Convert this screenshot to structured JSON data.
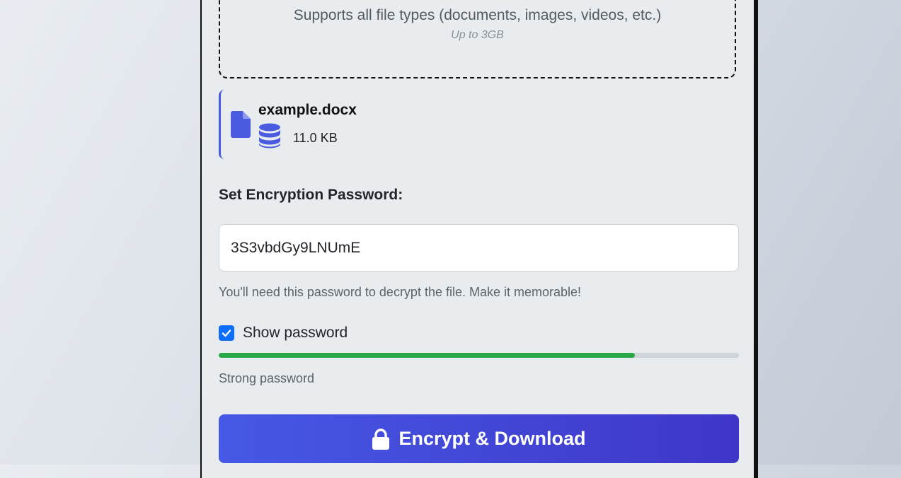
{
  "dropzone": {
    "text": "Supports all file types (documents, images, videos, etc.)",
    "limit": "Up to 3GB"
  },
  "file": {
    "name": "example.docx",
    "size": "11.0 KB",
    "icon": "file-icon",
    "size_icon": "database-icon"
  },
  "password": {
    "label": "Set Encryption Password:",
    "value": "3S3vbdGy9LNUmE",
    "hint": "You'll need this password to decrypt the file. Make it memorable!",
    "show_label": "Show password",
    "show_checked": true,
    "strength_fraction": 0.8,
    "strength_text": "Strong password"
  },
  "action": {
    "label": "Encrypt & Download",
    "icon": "lock-icon"
  },
  "colors": {
    "accent": "#4a5be0",
    "checkbox": "#0d6efd",
    "strength": "#28a745",
    "button_start": "#4659e5",
    "button_end": "#3f36c8"
  }
}
